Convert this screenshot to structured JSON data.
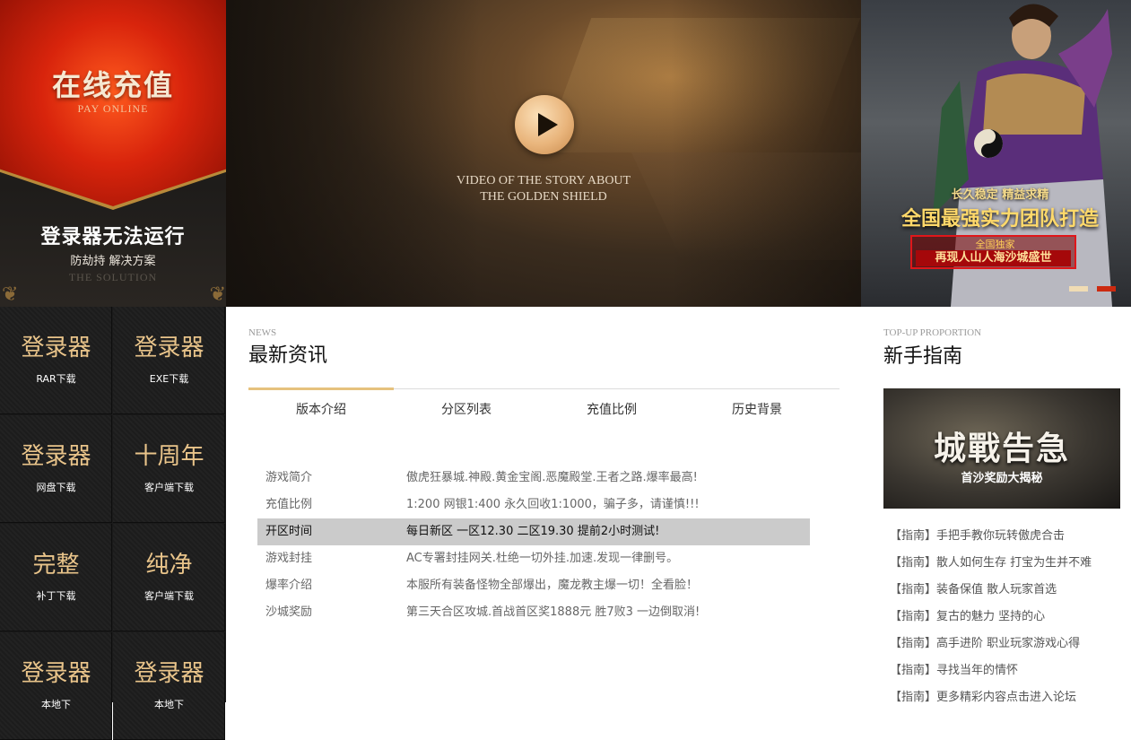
{
  "pay_panel": {
    "title": "在线充值",
    "subtitle": "PAY ONLINE",
    "issue_title": "登录器无法运行",
    "issue_desc": "防劫持 解决方案",
    "issue_en": "THE SOLUTION"
  },
  "video_panel": {
    "caption_line1": "VIDEO OF THE STORY ABOUT",
    "caption_line2": "THE GOLDEN SHIELD"
  },
  "promo_banner": {
    "line1": "长久稳定  精益求精",
    "line2": "全国最强实力团队打造",
    "line3": "全国独家",
    "line4": "再现人山人海沙城盛世"
  },
  "downloads": [
    {
      "big": "登录器",
      "small": "RAR下载"
    },
    {
      "big": "登录器",
      "small": "EXE下载"
    },
    {
      "big": "登录器",
      "small": "网盘下载"
    },
    {
      "big": "十周年",
      "small": "客户端下载"
    },
    {
      "big": "完整",
      "small": "补丁下载"
    },
    {
      "big": "纯净",
      "small": "客户端下载"
    },
    {
      "big": "登录器",
      "small": "本地下"
    },
    {
      "big": "登录器",
      "small": "本地下"
    }
  ],
  "news": {
    "section_en": "NEWS",
    "section_title": "最新资讯",
    "tabs": [
      "版本介绍",
      "分区列表",
      "充值比例",
      "历史背景"
    ],
    "rows": [
      {
        "key": "游戏简介",
        "value": "傲虎狂暴城.神殿.黄金宝阁.恶魔殿堂.王者之路.爆率最高!"
      },
      {
        "key": "充值比例",
        "value": "1:200 网银1:400 永久回收1:1000，骗子多，请谨慎!!!"
      },
      {
        "key": "开区时间",
        "value": "每日新区 一区12.30 二区19.30 提前2小时测试!"
      },
      {
        "key": "游戏封挂",
        "value": "AC专署封挂网关.杜绝一切外挂.加速.发现一律删号。"
      },
      {
        "key": "爆率介绍",
        "value": "本服所有装备怪物全部爆出，魔龙教主爆一切！全看脸！"
      },
      {
        "key": "沙城奖励",
        "value": "第三天合区攻城.首战首区奖1888元 胜7败3 一边倒取消!"
      }
    ]
  },
  "guide": {
    "section_en": "TOP-UP PROPORTION",
    "section_title": "新手指南",
    "banner_title": "城戰告急",
    "banner_sub": "首沙奖励大揭秘",
    "links": [
      "【指南】手把手教你玩转傲虎合击",
      "【指南】散人如何生存 打宝为生并不难",
      "【指南】装备保值 散人玩家首选",
      "【指南】复古的魅力 坚持的心",
      "【指南】高手进阶 职业玩家游戏心得",
      "【指南】寻找当年的情怀",
      "【指南】更多精彩内容点击进入论坛"
    ]
  },
  "colors": {
    "accent_gold": "#e6c27e",
    "active_row": "#cbcbcb",
    "slider_active": "#cc2a10",
    "slider_inactive": "#f0dcb4"
  }
}
